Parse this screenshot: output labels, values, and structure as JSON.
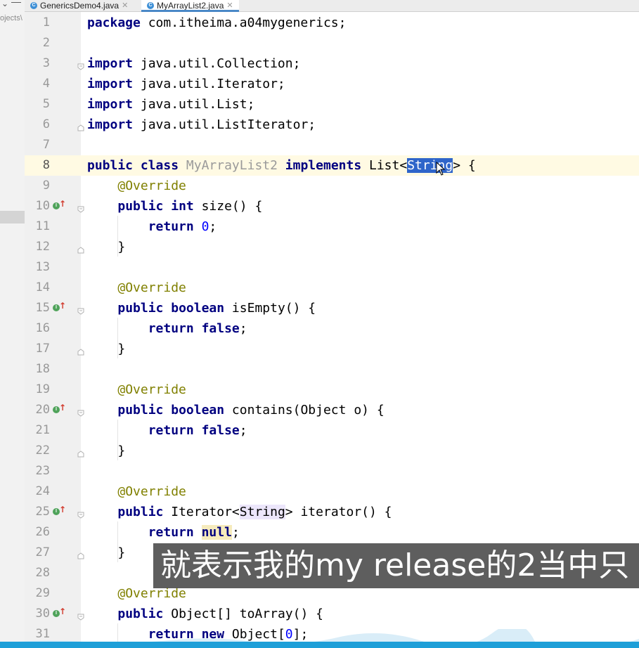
{
  "project_panel": {
    "text": "ojects\\"
  },
  "tabs": [
    {
      "label": "GenericsDemo4.java",
      "icon": "class-icon",
      "active": false
    },
    {
      "label": "MyArrayList2.java",
      "icon": "class-icon",
      "active": true
    }
  ],
  "editor": {
    "current_line": 8,
    "lines": [
      {
        "n": "1",
        "text": "package com.itheima.a04mygenerics;"
      },
      {
        "n": "2",
        "text": ""
      },
      {
        "n": "3",
        "text": "import java.util.Collection;"
      },
      {
        "n": "4",
        "text": "import java.util.Iterator;"
      },
      {
        "n": "5",
        "text": "import java.util.List;"
      },
      {
        "n": "6",
        "text": "import java.util.ListIterator;"
      },
      {
        "n": "7",
        "text": ""
      },
      {
        "n": "8",
        "text": "public class MyArrayList2 implements List<String> {"
      },
      {
        "n": "9",
        "text": "    @Override"
      },
      {
        "n": "10",
        "text": "    public int size() {"
      },
      {
        "n": "11",
        "text": "        return 0;"
      },
      {
        "n": "12",
        "text": "    }"
      },
      {
        "n": "13",
        "text": ""
      },
      {
        "n": "14",
        "text": "    @Override"
      },
      {
        "n": "15",
        "text": "    public boolean isEmpty() {"
      },
      {
        "n": "16",
        "text": "        return false;"
      },
      {
        "n": "17",
        "text": "    }"
      },
      {
        "n": "18",
        "text": ""
      },
      {
        "n": "19",
        "text": "    @Override"
      },
      {
        "n": "20",
        "text": "    public boolean contains(Object o) {"
      },
      {
        "n": "21",
        "text": "        return false;"
      },
      {
        "n": "22",
        "text": "    }"
      },
      {
        "n": "23",
        "text": ""
      },
      {
        "n": "24",
        "text": "    @Override"
      },
      {
        "n": "25",
        "text": "    public Iterator<String> iterator() {"
      },
      {
        "n": "26",
        "text": "        return null;"
      },
      {
        "n": "27",
        "text": "    }"
      },
      {
        "n": "28",
        "text": ""
      },
      {
        "n": "29",
        "text": "    @Override"
      },
      {
        "n": "30",
        "text": "    public Object[] toArray() {"
      },
      {
        "n": "31",
        "text": "        return new Object[0];"
      }
    ]
  },
  "subtitle": "就表示我的my release的2当中只",
  "colors": {
    "keyword": "#000080",
    "annotation": "#808000",
    "number": "#0000ff",
    "selection": "#2f65ca",
    "current_line": "#fffae3",
    "gutter": "#f0f0f0",
    "bottom_bar": "#1e9fd8"
  }
}
